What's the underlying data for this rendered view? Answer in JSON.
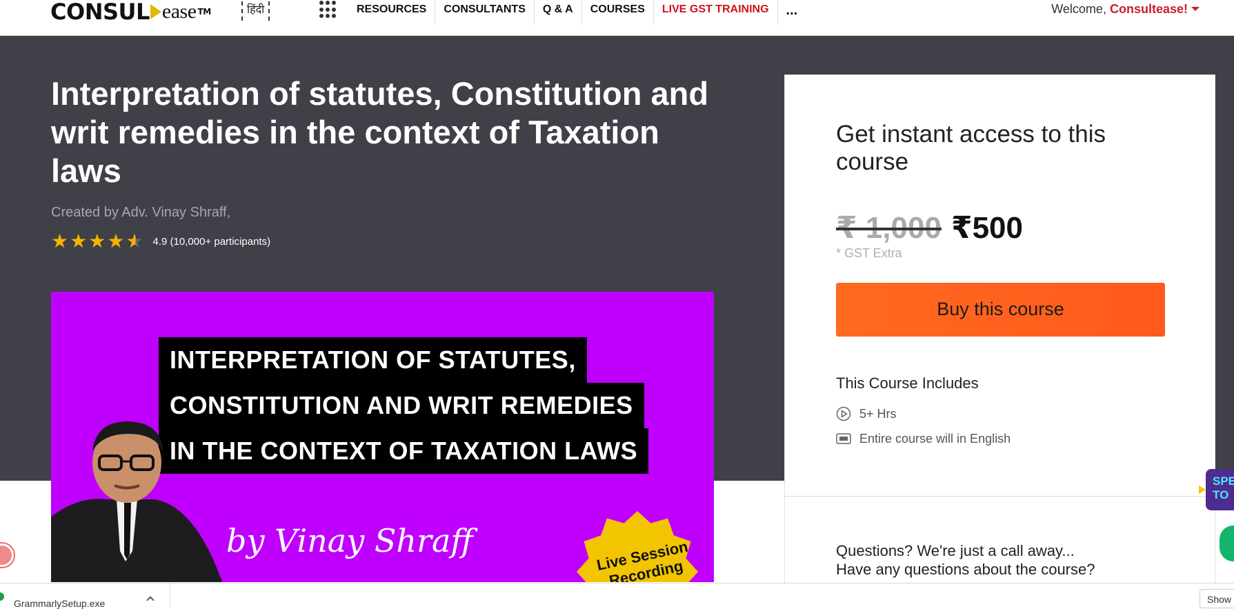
{
  "nav": {
    "logo_main": "CONSUL",
    "logo_ease": "ease",
    "logo_tm": "TM",
    "hindi": "हिंदी",
    "menu": [
      "RESOURCES",
      "CONSULTANTS",
      "Q & A",
      "COURSES",
      "LIVE GST TRAINING",
      "..."
    ],
    "welcome": "Welcome,",
    "user": "Consultease!"
  },
  "course": {
    "title": "Interpretation of statutes, Constitution and writ remedies in the context of Taxation laws",
    "created_by": "Created by Adv. Vinay Shraff,",
    "rating_text": "4.9 (10,000+ participants)",
    "rating": 4.9
  },
  "thumbnail": {
    "lines": [
      "INTERPRETATION OF STATUTES,",
      "CONSTITUTION AND WRIT REMEDIES",
      "IN THE CONTEXT OF TAXATION LAWS"
    ],
    "byline": "by Vinay Shraff",
    "badge": "Live Session Recording"
  },
  "purchase": {
    "heading": "Get instant access to this course",
    "old_price": "₹ 1,000",
    "new_price": "₹500",
    "gst": "* GST Extra",
    "buy_label": "Buy this course",
    "includes_title": "This Course Includes",
    "includes": [
      {
        "icon": "play-circle-icon",
        "text": "5+ Hrs"
      },
      {
        "icon": "language-icon",
        "text": "Entire course will in English"
      }
    ],
    "questions": [
      "Questions? We're just a call away...",
      "Have any questions about the course?"
    ]
  },
  "widgets": {
    "speak": "SPE TO"
  },
  "downloads": {
    "file": "GrammarlySetup.exe",
    "show_all": "Show"
  },
  "colors": {
    "hero_bg": "#3f4048",
    "accent": "#ff5a1c",
    "thumb_bg": "#c000ff",
    "live_red": "#d0121b"
  }
}
